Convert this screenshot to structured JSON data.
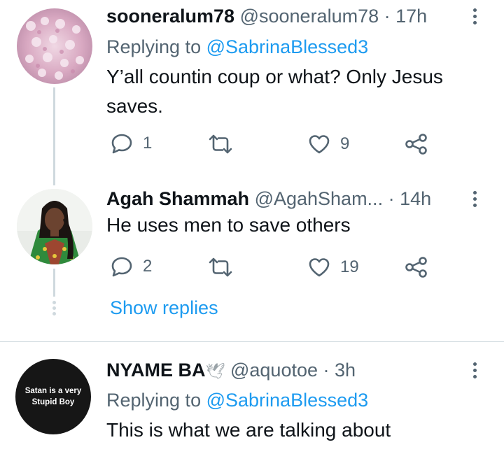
{
  "tweets": [
    {
      "name": "sooneralum78",
      "handle": "@sooneralum78",
      "time": "· 17h",
      "replying_prefix": "Replying to",
      "replying_to": "@SabrinaBlessed3",
      "text": "Y’all countin coup or what? Only Jesus saves.",
      "replies": "1",
      "retweets": "",
      "likes": "9"
    },
    {
      "name": "Agah Shammah",
      "handle": "@AgahSham...",
      "time": "· 14h",
      "text": "He uses men to save others",
      "replies": "2",
      "retweets": "",
      "likes": "19"
    },
    {
      "name": "NYAME BA",
      "name_emoji": "🕊",
      "handle": "@aquotoe",
      "time": "· 3h",
      "replying_prefix": "Replying to",
      "replying_to": "@SabrinaBlessed3",
      "text": "This is what we are talking about",
      "avatar_text": "Satan is a very Stupid Boy"
    }
  ],
  "show_replies": "Show replies",
  "colors": {
    "accent": "#1d9bf0",
    "secondary_text": "#536471",
    "thread_line": "#cfd9de"
  }
}
